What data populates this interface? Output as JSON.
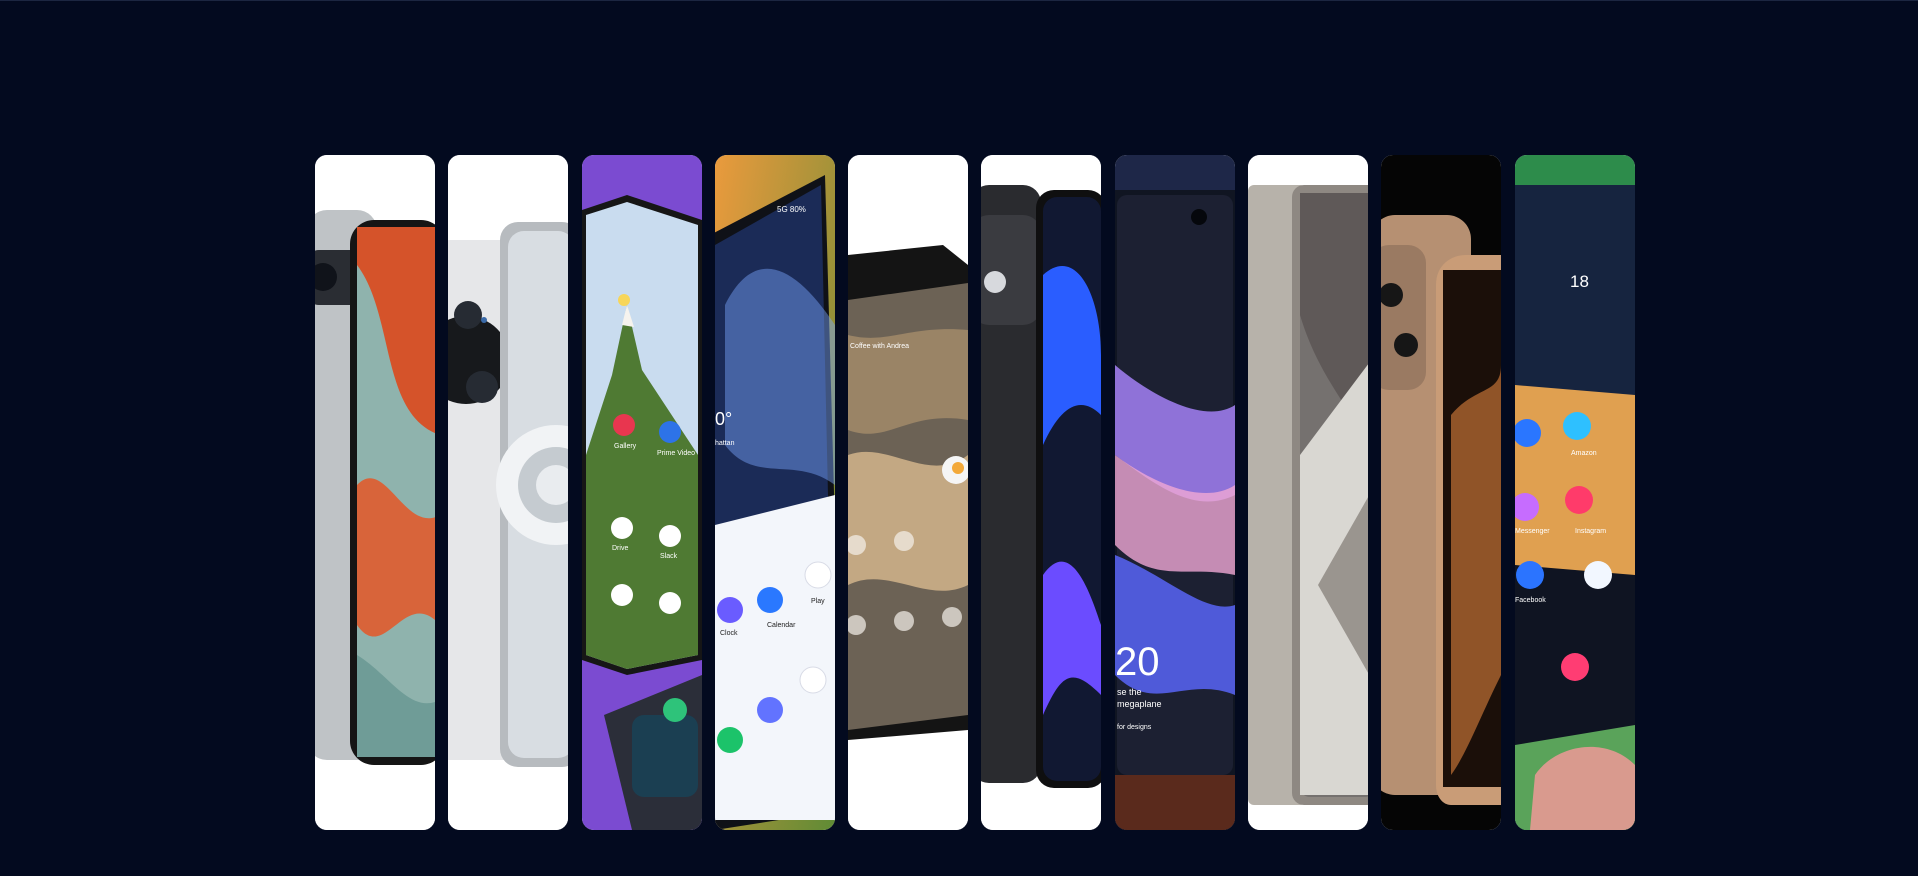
{
  "gallery": {
    "cards": [
      {
        "name": "phone-card-1",
        "background": "#ffffff",
        "accent": "#d85a2a"
      },
      {
        "name": "phone-card-2",
        "background": "#ffffff",
        "accent": "#c9cdd1"
      },
      {
        "name": "phone-card-3",
        "background": "#7b4bd1",
        "accent": "#5b8f3d"
      },
      {
        "name": "phone-card-4",
        "background": "#e7a04a",
        "accent": "#2b3f7a"
      },
      {
        "name": "phone-card-5",
        "background": "#ffffff",
        "accent": "#7d6b57"
      },
      {
        "name": "phone-card-6",
        "background": "#ffffff",
        "accent": "#4a4dff"
      },
      {
        "name": "phone-card-7",
        "background": "#1e2748",
        "accent": "#c27ae0"
      },
      {
        "name": "phone-card-8",
        "background": "#ffffff",
        "accent": "#a7a39e"
      },
      {
        "name": "phone-card-9",
        "background": "#050505",
        "accent": "#d9a26a"
      },
      {
        "name": "phone-card-10",
        "background": "#2d8c4b",
        "accent": "#ff7a1a"
      }
    ],
    "screen_text": {
      "card3_apps": [
        "Gallery",
        "Prime Video",
        "Drive",
        "Slack"
      ],
      "card4_status": "5G 80%",
      "card4_apps": [
        "Clock",
        "Calendar",
        "Play"
      ],
      "card4_time": "0°",
      "card4_city": "hattan",
      "card5_note": "Coffee with Andrea",
      "card7_time": "20",
      "card7_sub": "se the",
      "card7_sub2": "megaplane",
      "card7_bottom": "for designs",
      "card10_weather": "18",
      "card10_apps": [
        "Amazon",
        "Facebook",
        "Instagram",
        "Messenger"
      ]
    }
  }
}
